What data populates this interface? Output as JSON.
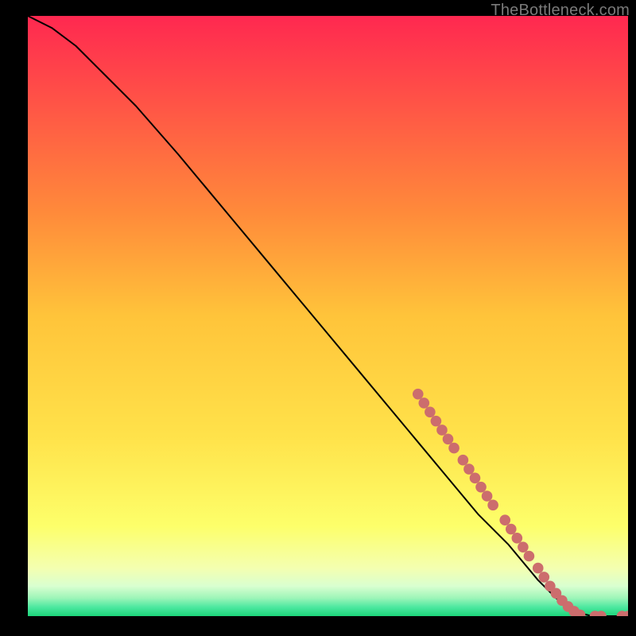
{
  "watermark": "TheBottleneck.com",
  "chart_data": {
    "type": "line",
    "title": "",
    "xlabel": "",
    "ylabel": "",
    "xlim": [
      0,
      100
    ],
    "ylim": [
      0,
      100
    ],
    "grid": false,
    "legend": false,
    "background_bands": [
      {
        "y_stop_pct": 0,
        "color": "#ff2850"
      },
      {
        "y_stop_pct": 33,
        "color": "#ff8b3a"
      },
      {
        "y_stop_pct": 50,
        "color": "#ffc43a"
      },
      {
        "y_stop_pct": 70,
        "color": "#ffe24a"
      },
      {
        "y_stop_pct": 85,
        "color": "#fdff6a"
      },
      {
        "y_stop_pct": 92,
        "color": "#f4ffb0"
      },
      {
        "y_stop_pct": 95,
        "color": "#d9ffd0"
      },
      {
        "y_stop_pct": 97,
        "color": "#9cf5b8"
      },
      {
        "y_stop_pct": 98.5,
        "color": "#4de8a0"
      },
      {
        "y_stop_pct": 100,
        "color": "#1cd57a"
      }
    ],
    "series": [
      {
        "name": "curve",
        "stroke": "#000000",
        "x": [
          0,
          4,
          8,
          12,
          18,
          25,
          30,
          35,
          40,
          45,
          50,
          55,
          60,
          65,
          70,
          75,
          80,
          85,
          88,
          90,
          92,
          94,
          96,
          98,
          100
        ],
        "y": [
          100,
          98,
          95,
          91,
          85,
          77,
          71,
          65,
          59,
          53,
          47,
          41,
          35,
          29,
          23,
          17,
          12,
          6,
          3,
          1.5,
          0.5,
          0,
          0,
          0,
          0
        ]
      }
    ],
    "markers": {
      "name": "points",
      "color": "#cc6d6d",
      "radius_pct": 0.9,
      "points": [
        {
          "x": 65,
          "y": 37
        },
        {
          "x": 66,
          "y": 35.5
        },
        {
          "x": 67,
          "y": 34
        },
        {
          "x": 68,
          "y": 32.5
        },
        {
          "x": 69,
          "y": 31
        },
        {
          "x": 70,
          "y": 29.5
        },
        {
          "x": 71,
          "y": 28
        },
        {
          "x": 72.5,
          "y": 26
        },
        {
          "x": 73.5,
          "y": 24.5
        },
        {
          "x": 74.5,
          "y": 23
        },
        {
          "x": 75.5,
          "y": 21.5
        },
        {
          "x": 76.5,
          "y": 20
        },
        {
          "x": 77.5,
          "y": 18.5
        },
        {
          "x": 79.5,
          "y": 16
        },
        {
          "x": 80.5,
          "y": 14.5
        },
        {
          "x": 81.5,
          "y": 13
        },
        {
          "x": 82.5,
          "y": 11.5
        },
        {
          "x": 83.5,
          "y": 10
        },
        {
          "x": 85,
          "y": 8
        },
        {
          "x": 86,
          "y": 6.5
        },
        {
          "x": 87,
          "y": 5
        },
        {
          "x": 88,
          "y": 3.8
        },
        {
          "x": 89,
          "y": 2.6
        },
        {
          "x": 90,
          "y": 1.6
        },
        {
          "x": 91,
          "y": 0.8
        },
        {
          "x": 92,
          "y": 0.2
        },
        {
          "x": 94.5,
          "y": 0
        },
        {
          "x": 95.5,
          "y": 0
        },
        {
          "x": 99,
          "y": 0
        },
        {
          "x": 100,
          "y": 0
        }
      ]
    }
  }
}
